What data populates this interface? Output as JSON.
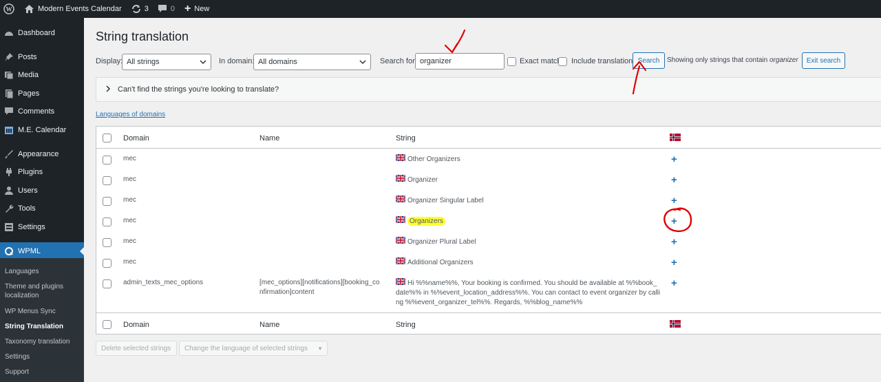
{
  "adminbar": {
    "site_name": "Modern Events Calendar",
    "updates_count": "3",
    "comments_count": "0",
    "new_label": "New"
  },
  "sidebar": {
    "items": [
      {
        "label": "Dashboard",
        "icon": "dashboard-icon"
      },
      {
        "label": "Posts",
        "icon": "pin-icon"
      },
      {
        "label": "Media",
        "icon": "media-icon"
      },
      {
        "label": "Pages",
        "icon": "pages-icon"
      },
      {
        "label": "Comments",
        "icon": "comment-icon"
      },
      {
        "label": "M.E. Calendar",
        "icon": "calendar-icon"
      },
      {
        "label": "Appearance",
        "icon": "brush-icon"
      },
      {
        "label": "Plugins",
        "icon": "plugin-icon"
      },
      {
        "label": "Users",
        "icon": "users-icon"
      },
      {
        "label": "Tools",
        "icon": "wrench-icon"
      },
      {
        "label": "Settings",
        "icon": "settings-icon"
      },
      {
        "label": "WPML",
        "icon": "wpml-icon"
      }
    ],
    "submenu": [
      "Languages",
      "Theme and plugins localization",
      "WP Menus Sync",
      "String Translation",
      "Taxonomy translation",
      "Settings",
      "Support"
    ]
  },
  "page": {
    "title": "String translation",
    "display_label": "Display:",
    "display_value": "All strings",
    "domain_label": "In domain:",
    "domain_value": "All domains",
    "search_label": "Search for:",
    "search_value": "organizer",
    "exact_match_label": "Exact match",
    "include_translations_label": "Include translations",
    "search_button": "Search",
    "showing_prefix": "Showing only strings that contain ",
    "showing_term": "organizer",
    "exit_search_button": "Exit search",
    "help_text": "Can't find the strings you're looking to translate?",
    "languages_link": "Languages of domains"
  },
  "table": {
    "headers": {
      "domain": "Domain",
      "name": "Name",
      "string": "String"
    },
    "rows": [
      {
        "domain": "mec",
        "name": "",
        "string": "Other Organizers"
      },
      {
        "domain": "mec",
        "name": "",
        "string": "Organizer"
      },
      {
        "domain": "mec",
        "name": "",
        "string": "Organizer Singular Label"
      },
      {
        "domain": "mec",
        "name": "",
        "string": "Organizers"
      },
      {
        "domain": "mec",
        "name": "",
        "string": "Organizer Plural Label"
      },
      {
        "domain": "mec",
        "name": "",
        "string": "Additional Organizers"
      },
      {
        "domain": "admin_texts_mec_options",
        "name_lines": [
          "[mec_options][notifications][booking_co",
          "nfirmation]content"
        ],
        "string_lines": [
          "Hi %%name%%, Your booking is confirmed. You should be available at %%book_",
          "date%% in %%event_location_address%%. You can contact to event organizer by calli",
          "ng %%event_organizer_tel%%. Regards, %%blog_name%%"
        ]
      }
    ],
    "add_translation_symbol": "+"
  },
  "bulk": {
    "delete_button": "Delete selected strings",
    "change_language_select": "Change the language of selected strings"
  },
  "colors": {
    "admin_dark": "#1d2327",
    "accent_blue": "#2271b1",
    "annotation_red": "#e00000",
    "highlight_yellow": "#ffff33"
  }
}
